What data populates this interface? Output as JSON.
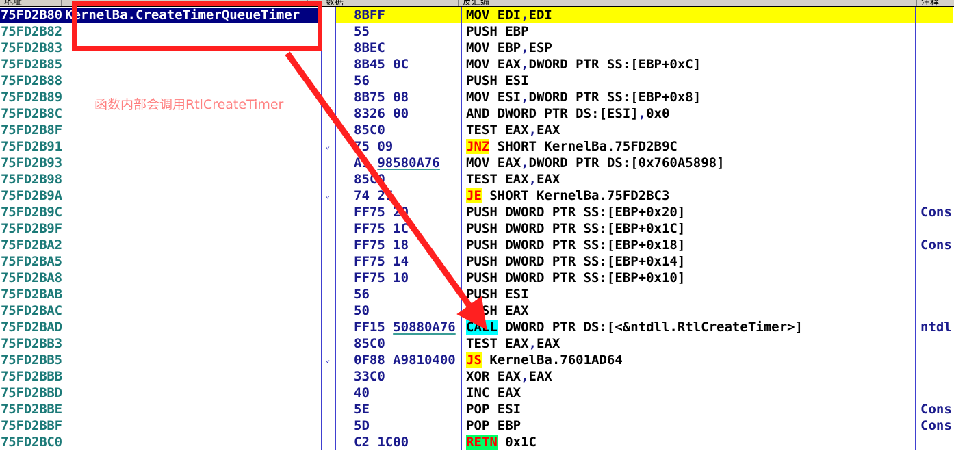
{
  "window": {
    "columns": [
      {
        "key": "address",
        "label": "地址"
      },
      {
        "key": "gutter",
        "label": ""
      },
      {
        "key": "machine_code",
        "label": "数据"
      },
      {
        "key": "disassembly",
        "label": "反汇编"
      },
      {
        "key": "comment",
        "label": "注释"
      }
    ]
  },
  "colors": {
    "address_text": "#1c7a78",
    "hex_text": "#1a1a8c",
    "disasm_text": "#000000",
    "selected_bg": "#000080",
    "highlight_bg": "#ffff00",
    "jump_token_bg": "#ffff00",
    "jump_token_fg": "#ff0000",
    "call_token_bg": "#00ffff",
    "retn_token_bg": "#00ff66",
    "annotation_red": "#ff2020",
    "annotation_text": "#ff8080",
    "separator_blue": "#4040d0",
    "hex_underline": "#3a9d96"
  },
  "annotations": {
    "rect_label": "highlight-box-function-name",
    "note_text": "函数内部会调用RtlCreateTimer",
    "arrow_label": "arrow-to-call-instruction"
  },
  "rows": [
    {
      "address": "75FD2B80",
      "label": "KernelBa.CreateTimerQueueTimer",
      "hex": "8BFF",
      "hex_ref": "",
      "disasm_parts": [
        {
          "text": "MOV EDI",
          "style": "plain"
        },
        {
          "text": ",",
          "style": "comma"
        },
        {
          "text": "EDI",
          "style": "plain"
        }
      ],
      "comment": "",
      "selected": true,
      "chevron": false
    },
    {
      "address": "75FD2B82",
      "label": "",
      "hex": "55",
      "hex_ref": "",
      "disasm_parts": [
        {
          "text": "PUSH EBP",
          "style": "plain"
        }
      ],
      "comment": "",
      "selected": false,
      "chevron": false
    },
    {
      "address": "75FD2B83",
      "label": "",
      "hex": "8BEC",
      "hex_ref": "",
      "disasm_parts": [
        {
          "text": "MOV EBP",
          "style": "plain"
        },
        {
          "text": ",",
          "style": "comma"
        },
        {
          "text": "ESP",
          "style": "plain"
        }
      ],
      "comment": "",
      "selected": false,
      "chevron": false
    },
    {
      "address": "75FD2B85",
      "label": "",
      "hex": "8B45 0C",
      "hex_ref": "",
      "disasm_parts": [
        {
          "text": "MOV EAX",
          "style": "plain"
        },
        {
          "text": ",",
          "style": "comma"
        },
        {
          "text": "DWORD PTR SS:[EBP+0xC]",
          "style": "plain"
        }
      ],
      "comment": "",
      "selected": false,
      "chevron": false
    },
    {
      "address": "75FD2B88",
      "label": "",
      "hex": "56",
      "hex_ref": "",
      "disasm_parts": [
        {
          "text": "PUSH ESI",
          "style": "plain"
        }
      ],
      "comment": "",
      "selected": false,
      "chevron": false
    },
    {
      "address": "75FD2B89",
      "label": "",
      "hex": "8B75 08",
      "hex_ref": "",
      "disasm_parts": [
        {
          "text": "MOV ESI",
          "style": "plain"
        },
        {
          "text": ",",
          "style": "comma"
        },
        {
          "text": "DWORD PTR SS:[EBP+0x8]",
          "style": "plain"
        }
      ],
      "comment": "",
      "selected": false,
      "chevron": false
    },
    {
      "address": "75FD2B8C",
      "label": "",
      "hex": "8326 00",
      "hex_ref": "",
      "disasm_parts": [
        {
          "text": "AND DWORD PTR DS:[ESI]",
          "style": "plain"
        },
        {
          "text": ",",
          "style": "comma"
        },
        {
          "text": "0x0",
          "style": "plain"
        }
      ],
      "comment": "",
      "selected": false,
      "chevron": false
    },
    {
      "address": "75FD2B8F",
      "label": "",
      "hex": "85C0",
      "hex_ref": "",
      "disasm_parts": [
        {
          "text": "TEST EAX",
          "style": "plain"
        },
        {
          "text": ",",
          "style": "comma"
        },
        {
          "text": "EAX",
          "style": "plain"
        }
      ],
      "comment": "",
      "selected": false,
      "chevron": false
    },
    {
      "address": "75FD2B91",
      "label": "",
      "hex": "75 09",
      "hex_ref": "",
      "disasm_parts": [
        {
          "text": "JNZ",
          "style": "jmp"
        },
        {
          "text": " SHORT KernelBa.75FD2B9C",
          "style": "plain"
        }
      ],
      "comment": "",
      "selected": false,
      "chevron": true
    },
    {
      "address": "75FD2B93",
      "label": "",
      "hex": "A1 ",
      "hex_ref": "98580A76",
      "disasm_parts": [
        {
          "text": "MOV EAX",
          "style": "plain"
        },
        {
          "text": ",",
          "style": "comma"
        },
        {
          "text": "DWORD PTR DS:[0x760A5898]",
          "style": "plain"
        }
      ],
      "comment": "",
      "selected": false,
      "chevron": false
    },
    {
      "address": "75FD2B98",
      "label": "",
      "hex": "85C0",
      "hex_ref": "",
      "disasm_parts": [
        {
          "text": "TEST EAX",
          "style": "plain"
        },
        {
          "text": ",",
          "style": "comma"
        },
        {
          "text": "EAX",
          "style": "plain"
        }
      ],
      "comment": "",
      "selected": false,
      "chevron": false
    },
    {
      "address": "75FD2B9A",
      "label": "",
      "hex": "74 27",
      "hex_ref": "",
      "disasm_parts": [
        {
          "text": "JE",
          "style": "jmp"
        },
        {
          "text": " SHORT KernelBa.75FD2BC3",
          "style": "plain"
        }
      ],
      "comment": "",
      "selected": false,
      "chevron": true
    },
    {
      "address": "75FD2B9C",
      "label": "",
      "hex": "FF75 20",
      "hex_ref": "",
      "disasm_parts": [
        {
          "text": "PUSH DWORD PTR SS:[EBP+0x20]",
          "style": "plain"
        }
      ],
      "comment": "Cons",
      "selected": false,
      "chevron": false
    },
    {
      "address": "75FD2B9F",
      "label": "",
      "hex": "FF75 1C",
      "hex_ref": "",
      "disasm_parts": [
        {
          "text": "PUSH DWORD PTR SS:[EBP+0x1C]",
          "style": "plain"
        }
      ],
      "comment": "",
      "selected": false,
      "chevron": false
    },
    {
      "address": "75FD2BA2",
      "label": "",
      "hex": "FF75 18",
      "hex_ref": "",
      "disasm_parts": [
        {
          "text": "PUSH DWORD PTR SS:[EBP+0x18]",
          "style": "plain"
        }
      ],
      "comment": "Cons",
      "selected": false,
      "chevron": false
    },
    {
      "address": "75FD2BA5",
      "label": "",
      "hex": "FF75 14",
      "hex_ref": "",
      "disasm_parts": [
        {
          "text": "PUSH DWORD PTR SS:[EBP+0x14]",
          "style": "plain"
        }
      ],
      "comment": "",
      "selected": false,
      "chevron": false
    },
    {
      "address": "75FD2BA8",
      "label": "",
      "hex": "FF75 10",
      "hex_ref": "",
      "disasm_parts": [
        {
          "text": "PUSH DWORD PTR SS:[EBP+0x10]",
          "style": "plain"
        }
      ],
      "comment": "",
      "selected": false,
      "chevron": false
    },
    {
      "address": "75FD2BAB",
      "label": "",
      "hex": "56",
      "hex_ref": "",
      "disasm_parts": [
        {
          "text": "PUSH ESI",
          "style": "plain"
        }
      ],
      "comment": "",
      "selected": false,
      "chevron": false
    },
    {
      "address": "75FD2BAC",
      "label": "",
      "hex": "50",
      "hex_ref": "",
      "disasm_parts": [
        {
          "text": "PUSH EAX",
          "style": "plain"
        }
      ],
      "comment": "",
      "selected": false,
      "chevron": false
    },
    {
      "address": "75FD2BAD",
      "label": "",
      "hex": "FF15 ",
      "hex_ref": "50880A76",
      "disasm_parts": [
        {
          "text": "CALL",
          "style": "call"
        },
        {
          "text": " DWORD PTR DS:[<&ntdll.RtlCreateTimer>]",
          "style": "plain"
        }
      ],
      "comment": "ntdl",
      "selected": false,
      "chevron": false
    },
    {
      "address": "75FD2BB3",
      "label": "",
      "hex": "85C0",
      "hex_ref": "",
      "disasm_parts": [
        {
          "text": "TEST EAX",
          "style": "plain"
        },
        {
          "text": ",",
          "style": "comma"
        },
        {
          "text": "EAX",
          "style": "plain"
        }
      ],
      "comment": "",
      "selected": false,
      "chevron": false
    },
    {
      "address": "75FD2BB5",
      "label": "",
      "hex": "0F88 A9810400",
      "hex_ref": "",
      "disasm_parts": [
        {
          "text": "JS",
          "style": "jmp"
        },
        {
          "text": " KernelBa.7601AD64",
          "style": "plain"
        }
      ],
      "comment": "",
      "selected": false,
      "chevron": true
    },
    {
      "address": "75FD2BBB",
      "label": "",
      "hex": "33C0",
      "hex_ref": "",
      "disasm_parts": [
        {
          "text": "XOR EAX",
          "style": "plain"
        },
        {
          "text": ",",
          "style": "comma"
        },
        {
          "text": "EAX",
          "style": "plain"
        }
      ],
      "comment": "",
      "selected": false,
      "chevron": false
    },
    {
      "address": "75FD2BBD",
      "label": "",
      "hex": "40",
      "hex_ref": "",
      "disasm_parts": [
        {
          "text": "INC EAX",
          "style": "plain"
        }
      ],
      "comment": "",
      "selected": false,
      "chevron": false
    },
    {
      "address": "75FD2BBE",
      "label": "",
      "hex": "5E",
      "hex_ref": "",
      "disasm_parts": [
        {
          "text": "POP ESI",
          "style": "plain"
        }
      ],
      "comment": "Cons",
      "selected": false,
      "chevron": false
    },
    {
      "address": "75FD2BBF",
      "label": "",
      "hex": "5D",
      "hex_ref": "",
      "disasm_parts": [
        {
          "text": "POP EBP",
          "style": "plain"
        }
      ],
      "comment": "Cons",
      "selected": false,
      "chevron": false
    },
    {
      "address": "75FD2BC0",
      "label": "",
      "hex": "C2 1C00",
      "hex_ref": "",
      "disasm_parts": [
        {
          "text": "RETN",
          "style": "retn"
        },
        {
          "text": " 0x1C",
          "style": "plain"
        }
      ],
      "comment": "",
      "selected": false,
      "chevron": false
    }
  ]
}
